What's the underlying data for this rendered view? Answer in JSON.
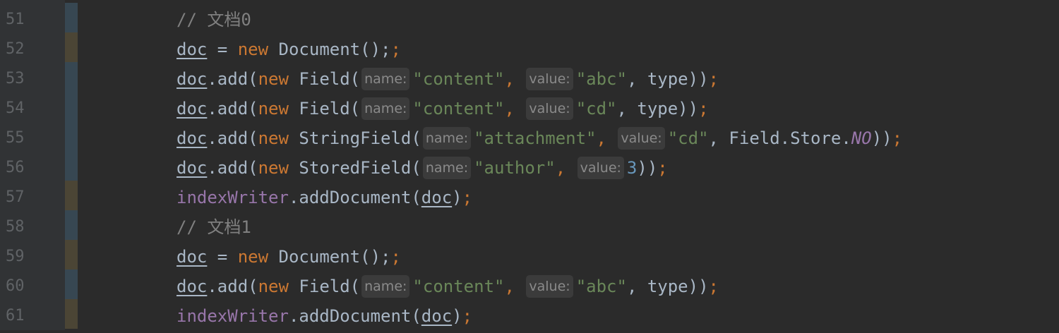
{
  "editor": {
    "colors": {
      "background": "#2b2b2b",
      "gutter": "#313335",
      "keyword": "#cc7832",
      "string": "#6a8759",
      "number": "#6897bb",
      "comment": "#808080",
      "field": "#9876aa",
      "text": "#a9b7c6"
    },
    "lines": [
      {
        "num": "51",
        "marker": "changed",
        "comment": "// 文档0"
      },
      {
        "num": "52",
        "marker": "added",
        "var": "doc",
        "eq": " = ",
        "kw_new": "new",
        "ctor": " Document();"
      },
      {
        "num": "53",
        "marker": "changed",
        "var": "doc",
        "call": ".add(",
        "kw_new": "new",
        "type_open": " Field(",
        "hint_name": "name:",
        "arg1": "\"content\"",
        "sep1": ", ",
        "hint_value": "value:",
        "arg2": "\"abc\"",
        "rest": ", type));"
      },
      {
        "num": "54",
        "marker": "changed",
        "var": "doc",
        "call": ".add(",
        "kw_new": "new",
        "type_open": " Field(",
        "hint_name": "name:",
        "arg1": "\"content\"",
        "sep1": ", ",
        "hint_value": "value:",
        "arg2": "\"cd\"",
        "rest": ", type));"
      },
      {
        "num": "55",
        "marker": "changed",
        "var": "doc",
        "call": ".add(",
        "kw_new": "new",
        "type_open": " StringField(",
        "hint_name": "name:",
        "arg1": "\"attachment\"",
        "sep1": ", ",
        "hint_value": "value:",
        "arg2": "\"cd\"",
        "mid": ", Field.Store.",
        "const": "NO",
        "rest": "));"
      },
      {
        "num": "56",
        "marker": "changed",
        "var": "doc",
        "call": ".add(",
        "kw_new": "new",
        "type_open": " StoredField(",
        "hint_name": "name:",
        "arg1": "\"author\"",
        "sep1": ", ",
        "hint_value": "value:",
        "num_arg": "3",
        "rest": "));"
      },
      {
        "num": "57",
        "marker": "added",
        "field": "indexWriter",
        "call": ".addDocument(",
        "arg_var": "doc",
        "rest": ");"
      },
      {
        "num": "58",
        "marker": "changed",
        "comment": "// 文档1"
      },
      {
        "num": "59",
        "marker": "added",
        "var": "doc",
        "eq": " = ",
        "kw_new": "new",
        "ctor": " Document();"
      },
      {
        "num": "60",
        "marker": "changed",
        "var": "doc",
        "call": ".add(",
        "kw_new": "new",
        "type_open": " Field(",
        "hint_name": "name:",
        "arg1": "\"content\"",
        "sep1": ", ",
        "hint_value": "value:",
        "arg2": "\"abc\"",
        "rest": ", type));"
      },
      {
        "num": "61",
        "marker": "added",
        "field": "indexWriter",
        "call": ".addDocument(",
        "arg_var": "doc",
        "rest": ");"
      }
    ]
  }
}
